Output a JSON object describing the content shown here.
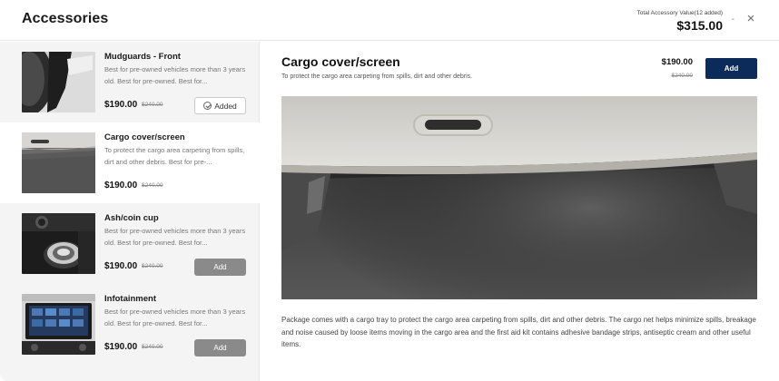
{
  "header": {
    "title": "Accessories",
    "total_label": "Total Accessory Value(12 added)",
    "total_value": "$315.00",
    "collapse_symbol": "-",
    "close_symbol": "×"
  },
  "items": [
    {
      "name": "Mudguards - Front",
      "description": "Best for pre-owned vehicles more than 3 years old. Best for pre-owned. Best for...",
      "price": "$190.00",
      "old_price": "$240.00",
      "action_label": "Added",
      "state": "added"
    },
    {
      "name": "Cargo cover/screen",
      "description": "To protect the cargo area carpeting from spills, dirt and other debris. Best for pre-...",
      "price": "$190.00",
      "old_price": "$240.00",
      "state": "selected"
    },
    {
      "name": "Ash/coin cup",
      "description": "Best for pre-owned vehicles more than 3 years old. Best for pre-owned. Best for...",
      "price": "$190.00",
      "old_price": "$240.00",
      "action_label": "Add",
      "state": "available"
    },
    {
      "name": "Infotainment",
      "description": "Best for pre-owned vehicles more than 3 years old. Best for pre-owned. Best for...",
      "price": "$190.00",
      "old_price": "$240.00",
      "action_label": "Add",
      "state": "available"
    }
  ],
  "detail": {
    "title": "Cargo cover/screen",
    "subtitle": "To protect the cargo area carpeting from spills, dirt and other debris.",
    "price": "$190.00",
    "old_price": "$240.00",
    "add_label": "Add",
    "description": "Package comes with a cargo tray to protect the cargo area carpeting from spills, dirt and other debris. The cargo net helps minimize spills, breakage and noise caused by loose items moving in the cargo area and the first aid kit contains adhesive bandage strips, antiseptic cream and other useful items."
  },
  "colors": {
    "primary_button": "#0c2b5b",
    "disabled_button": "#8a8a8a",
    "list_background": "#f4f4f4"
  }
}
